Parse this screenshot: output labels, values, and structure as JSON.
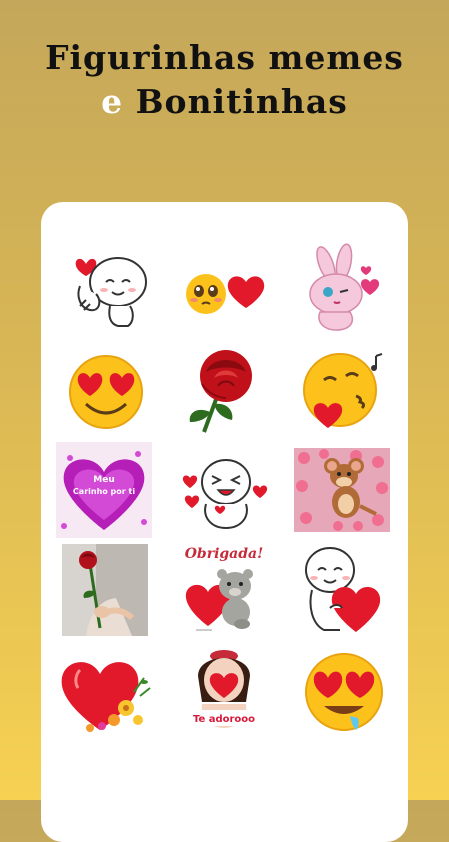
{
  "header": {
    "line1": "Figurinhas memes",
    "line2_accent": "e",
    "line2_rest": " Bonitinhas"
  },
  "stickers": [
    {
      "name": "love-gesture-character"
    },
    {
      "name": "shy-emoji-heart"
    },
    {
      "name": "bunny-kiss"
    },
    {
      "name": "heart-eyes-smile"
    },
    {
      "name": "red-rose"
    },
    {
      "name": "kissing-face-heart"
    },
    {
      "name": "heart-purple",
      "text_line1": "Meu",
      "text_line2": "Carinho por ti"
    },
    {
      "name": "line-character-hearts"
    },
    {
      "name": "jerry-mouse-hearts"
    },
    {
      "name": "man-holding-rose"
    },
    {
      "name": "teddy-obrigada",
      "text": "Obrigada!"
    },
    {
      "name": "character-hugging-heart"
    },
    {
      "name": "heart-flowers"
    },
    {
      "name": "girl-heart-te-adorooo",
      "text": "Te adorooo"
    },
    {
      "name": "heart-eyes-drool"
    }
  ],
  "colors": {
    "bg_top": "#c4a75a",
    "bg_bottom": "#f6d152",
    "heart_red": "#e2182b",
    "emoji_yellow": "#fcc21b"
  }
}
